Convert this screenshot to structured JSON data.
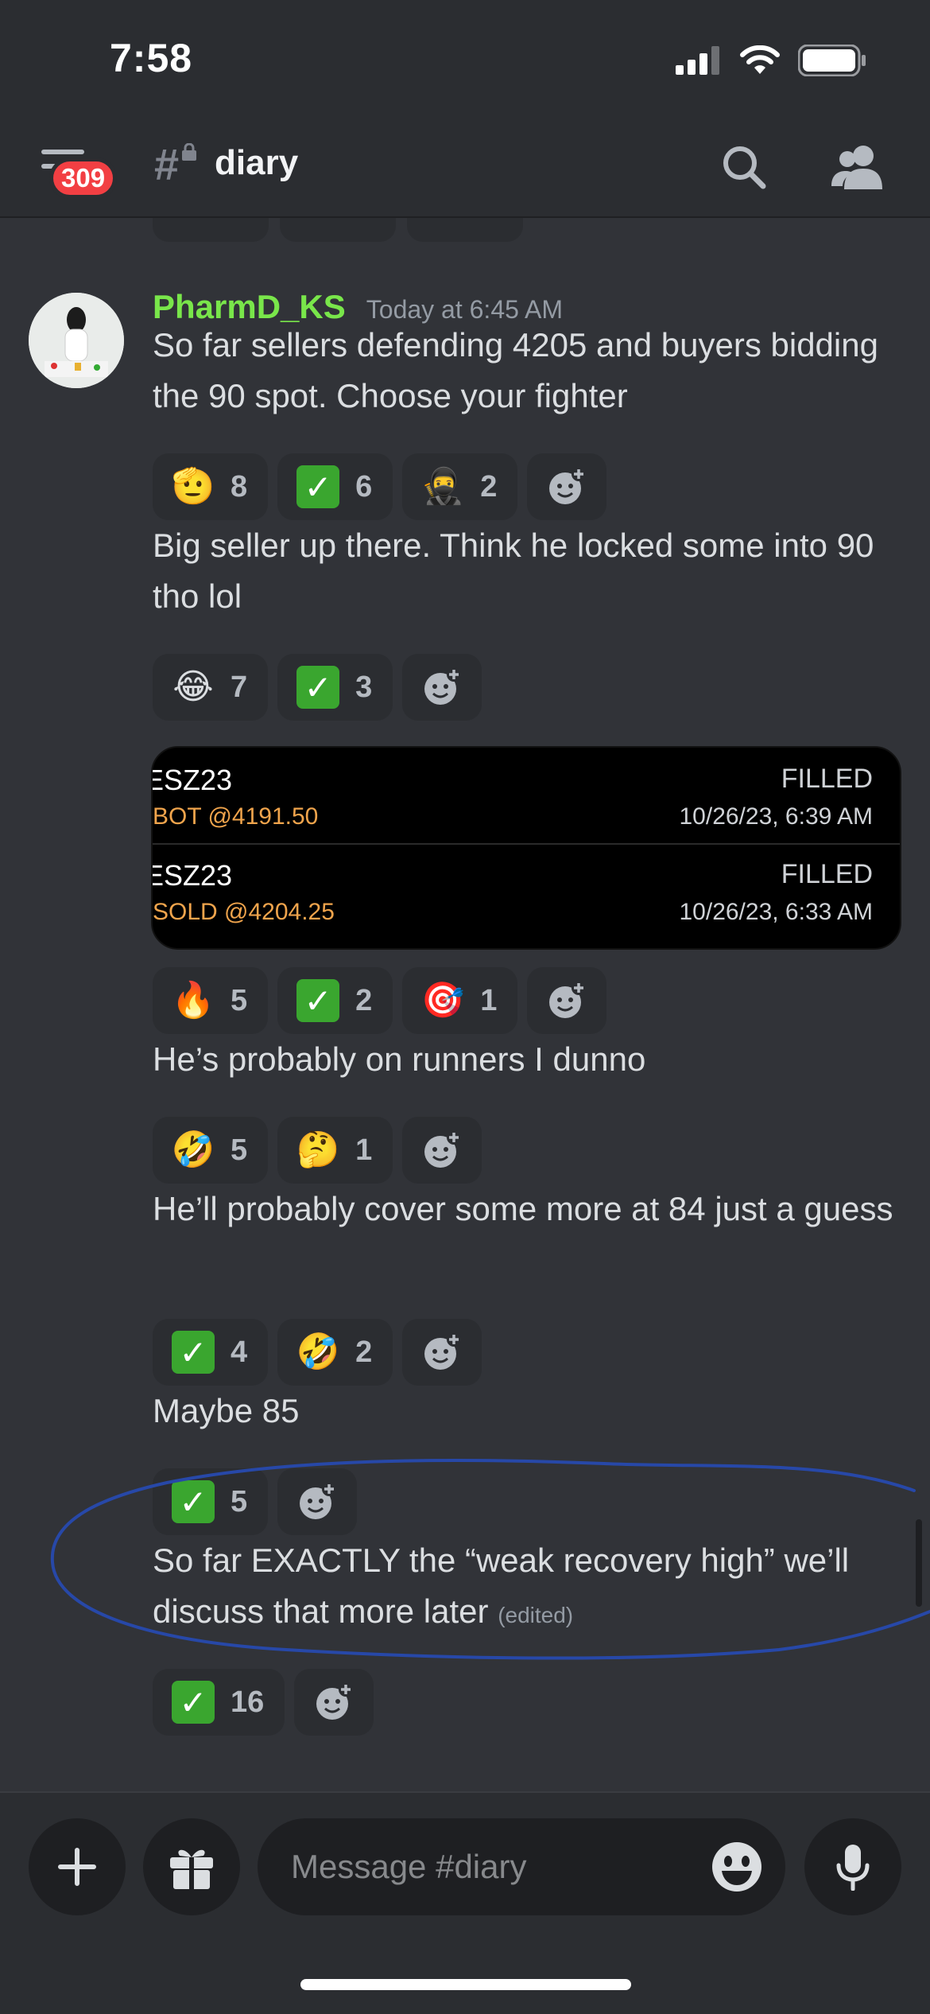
{
  "status_bar": {
    "time": "7:58"
  },
  "header": {
    "badge_count": "309",
    "channel_name": "diary"
  },
  "message_group": {
    "username": "PharmD_KS",
    "timestamp": "Today at 6:45 AM",
    "messages": [
      {
        "text": "So far sellers defending 4205 and buyers bidding the 90 spot. Choose your fighter",
        "reactions": [
          {
            "emoji": "🫡",
            "count": "8"
          },
          {
            "emoji": "✅",
            "count": "6"
          },
          {
            "emoji": "🥷",
            "count": "2"
          }
        ]
      },
      {
        "text": "Big seller up there. Think he locked some into 90 tho lol",
        "reactions": [
          {
            "emoji": "😂",
            "count": "7"
          },
          {
            "emoji": "✅",
            "count": "3"
          }
        ]
      },
      {
        "text": "",
        "trades": [
          {
            "symbol": "ESZ23",
            "side": "BOT @4191.50",
            "status": "FILLED",
            "date": "10/26/23, 6:39 AM"
          },
          {
            "symbol": "ESZ23",
            "side": "SOLD @4204.25",
            "status": "FILLED",
            "date": "10/26/23, 6:33 AM"
          }
        ],
        "reactions": [
          {
            "emoji": "🔥",
            "count": "5"
          },
          {
            "emoji": "✅",
            "count": "2"
          },
          {
            "emoji": "🎯",
            "count": "1"
          }
        ]
      },
      {
        "text": "He’s probably on runners I dunno",
        "reactions": [
          {
            "emoji": "🤣",
            "count": "5"
          },
          {
            "emoji": "🤔",
            "count": "1"
          }
        ]
      },
      {
        "text": "He’ll probably cover some more at 84 just a guess",
        "reactions": [
          {
            "emoji": "✅",
            "count": "4"
          },
          {
            "emoji": "🤣",
            "count": "2"
          }
        ]
      },
      {
        "text": "Maybe 85",
        "reactions": [
          {
            "emoji": "✅",
            "count": "5"
          }
        ]
      },
      {
        "text": "So far EXACTLY the “weak recovery high” we’ll discuss that more later",
        "edited_label": "(edited)",
        "reactions": [
          {
            "emoji": "✅",
            "count": "16"
          }
        ]
      }
    ]
  },
  "composer": {
    "placeholder": "Message #diary"
  },
  "colors": {
    "background": "#313338",
    "header_bg": "#2b2d31",
    "username": "#79e64a",
    "badge": "#f23f43",
    "check_green": "#3aa62f",
    "trade_side": "#f0a44c",
    "annotation_circle": "#2748a8"
  },
  "icons": [
    "menu-icon",
    "hash-lock-icon",
    "search-icon",
    "members-icon",
    "add-reaction-icon",
    "plus-icon",
    "gift-icon",
    "emoji-icon",
    "microphone-icon",
    "signal-icon",
    "wifi-icon",
    "battery-icon"
  ]
}
